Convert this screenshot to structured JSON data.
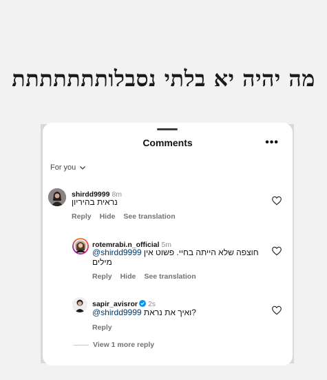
{
  "headline": "מה יהיה יא בלתי נסבלותתתתתתת",
  "sheet": {
    "title": "Comments",
    "more_label": "•••",
    "sort_label": "For you"
  },
  "comments": [
    {
      "username": "shirdd9999",
      "time": "8m",
      "text": "נראית בהיריון",
      "actions": [
        "Reply",
        "Hide",
        "See translation"
      ]
    },
    {
      "username": "rotemrabi.n_official",
      "time": "5m",
      "mention": "@shirdd9999",
      "text_line1": "חוצפה שלא הייתה בחיי. פשוט אין",
      "text_line2": "מילים",
      "actions": [
        "Reply",
        "Hide",
        "See translation"
      ]
    },
    {
      "username": "sapir_avisror",
      "time": "2s",
      "verified": true,
      "mention": "@shirdd9999",
      "text": "?ואיך את נראת",
      "actions": [
        "Reply"
      ]
    }
  ],
  "view_more": "View 1 more reply",
  "icons": [
    "heart-icon",
    "chevron-down-icon",
    "verified-badge-icon",
    "more-icon"
  ],
  "colors": {
    "mention": "#00376b",
    "verified": "#0095f6",
    "muted": "#737373"
  }
}
